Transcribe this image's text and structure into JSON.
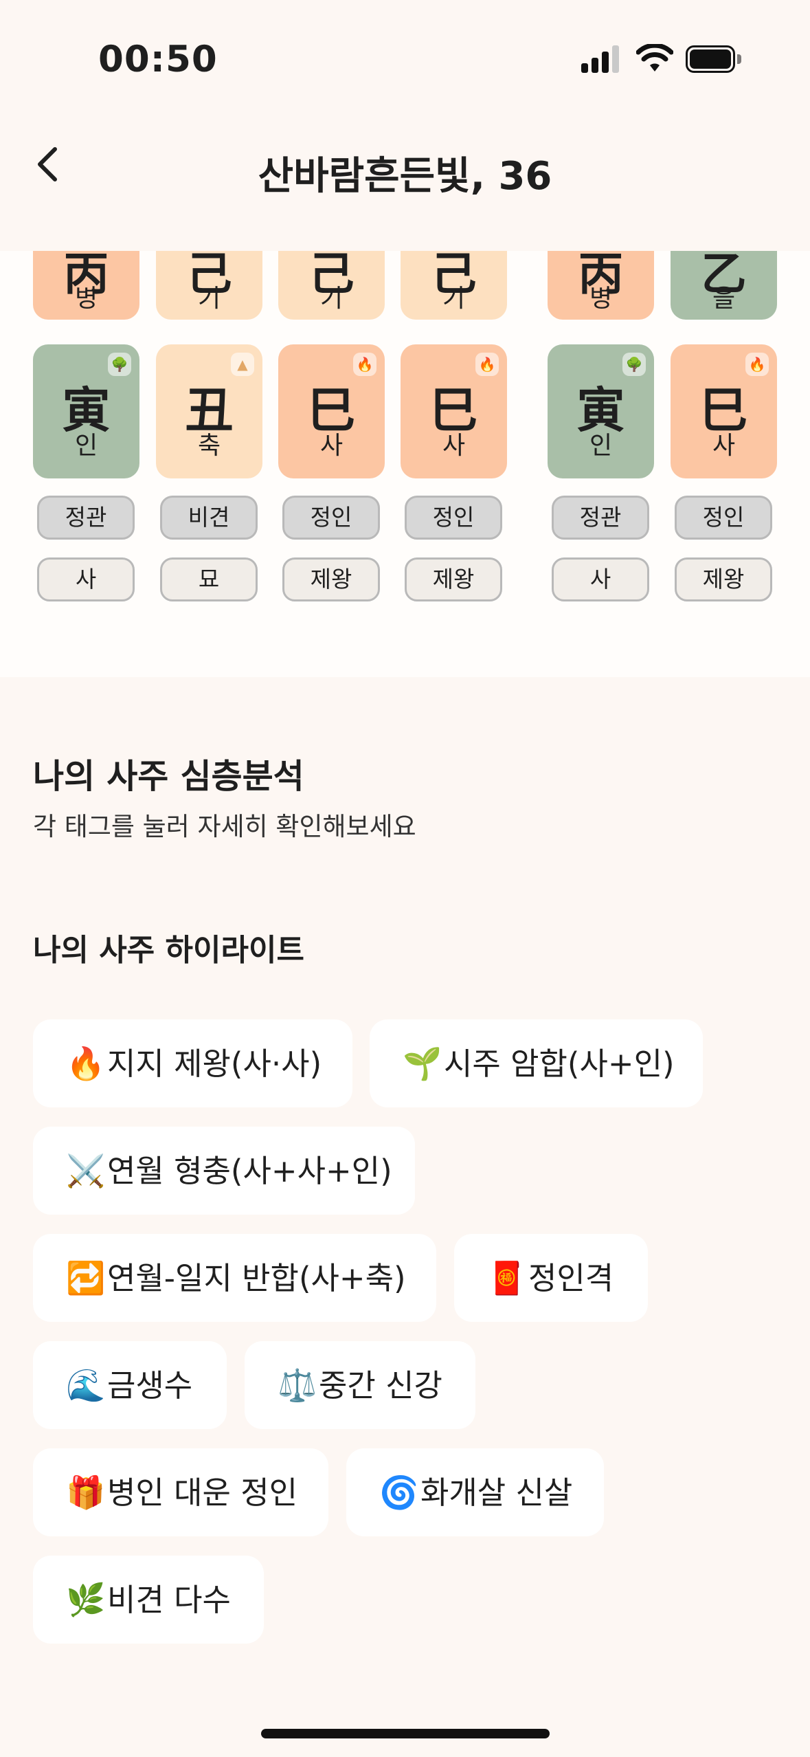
{
  "status_bar": {
    "time": "00:50"
  },
  "header": {
    "title": "산바람흔든빛, 36"
  },
  "pillars": {
    "stems": [
      {
        "hanja": "丙",
        "reading": "병",
        "color": "#fcc6a3"
      },
      {
        "hanja": "己",
        "reading": "기",
        "color": "#fde0c0"
      },
      {
        "hanja": "己",
        "reading": "기",
        "color": "#fde0c0"
      },
      {
        "hanja": "己",
        "reading": "기",
        "color": "#fde0c0"
      },
      {
        "hanja": "丙",
        "reading": "병",
        "color": "#fcc6a3"
      },
      {
        "hanja": "乙",
        "reading": "을",
        "color": "#a9bfa8"
      }
    ],
    "branches": [
      {
        "hanja": "寅",
        "reading": "인",
        "element_icon": "tree-icon",
        "color": "#a9bfa8"
      },
      {
        "hanja": "丑",
        "reading": "축",
        "element_icon": "earth-icon",
        "color": "#fde0c0"
      },
      {
        "hanja": "巳",
        "reading": "사",
        "element_icon": "fire-icon",
        "color": "#fcc6a3"
      },
      {
        "hanja": "巳",
        "reading": "사",
        "element_icon": "fire-icon",
        "color": "#fcc6a3"
      },
      {
        "hanja": "寅",
        "reading": "인",
        "element_icon": "tree-icon",
        "color": "#a9bfa8"
      },
      {
        "hanja": "巳",
        "reading": "사",
        "element_icon": "fire-icon",
        "color": "#fcc6a3"
      }
    ],
    "ten_gods": [
      "정관",
      "비견",
      "정인",
      "정인",
      "정관",
      "정인"
    ],
    "life_stages": [
      "사",
      "묘",
      "제왕",
      "제왕",
      "사",
      "제왕"
    ]
  },
  "analysis": {
    "title": "나의 사주 심층분석",
    "subtitle": "각 태그를 눌러 자세히 확인해보세요",
    "highlight_title": "나의 사주 하이라이트",
    "tags": [
      {
        "emoji": "🔥",
        "label": "지지 제왕(사·사)"
      },
      {
        "emoji": "🌱",
        "label": "시주 암합(사+인)"
      },
      {
        "emoji": "⚔️",
        "label": "연월 형충(사+사+인)"
      },
      {
        "emoji": "🔁",
        "label": "연월-일지 반합(사+축)"
      },
      {
        "emoji": "🧧",
        "label": "정인격"
      },
      {
        "emoji": "🌊",
        "label": "금생수"
      },
      {
        "emoji": "⚖️",
        "label": "중간 신강"
      },
      {
        "emoji": "🎁",
        "label": "병인 대운 정인"
      },
      {
        "emoji": "🌀",
        "label": "화개살 신살"
      },
      {
        "emoji": "🌿",
        "label": "비견 다수"
      }
    ]
  },
  "colors": {
    "background": "#fdf7f3",
    "orange": "#fcc6a3",
    "cream": "#fde0c0",
    "green": "#a9bfa8"
  }
}
